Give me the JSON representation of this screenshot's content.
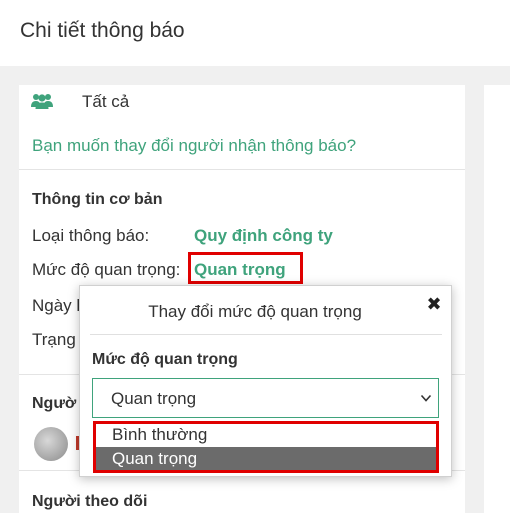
{
  "header": {
    "title": "Chi tiết thông báo"
  },
  "recipients": {
    "icon": "users-icon",
    "label": "Tất cả",
    "change_link": "Bạn muốn thay đổi người nhận thông báo?"
  },
  "basic_info": {
    "section_title": "Thông tin cơ bản",
    "type_label": "Loại thông báo:",
    "type_value": "Quy định công ty",
    "importance_label": "Mức độ quan trọng:",
    "importance_value": "Quan trọng",
    "date_label_partial": "Ngày l",
    "status_label_partial": "Trạng"
  },
  "recipient_section": {
    "title_partial": "Ngườ"
  },
  "followers": {
    "title": "Người theo dõi"
  },
  "popup": {
    "title": "Thay đổi mức độ quan trọng",
    "close_icon": "close-icon",
    "field_label": "Mức độ quan trọng",
    "selected_value": "Quan trọng",
    "options": [
      "Bình thường",
      "Quan trọng"
    ]
  },
  "colors": {
    "accent": "#3fa37c",
    "highlight": "#e00000",
    "selected_option": "#6b6b6b"
  }
}
